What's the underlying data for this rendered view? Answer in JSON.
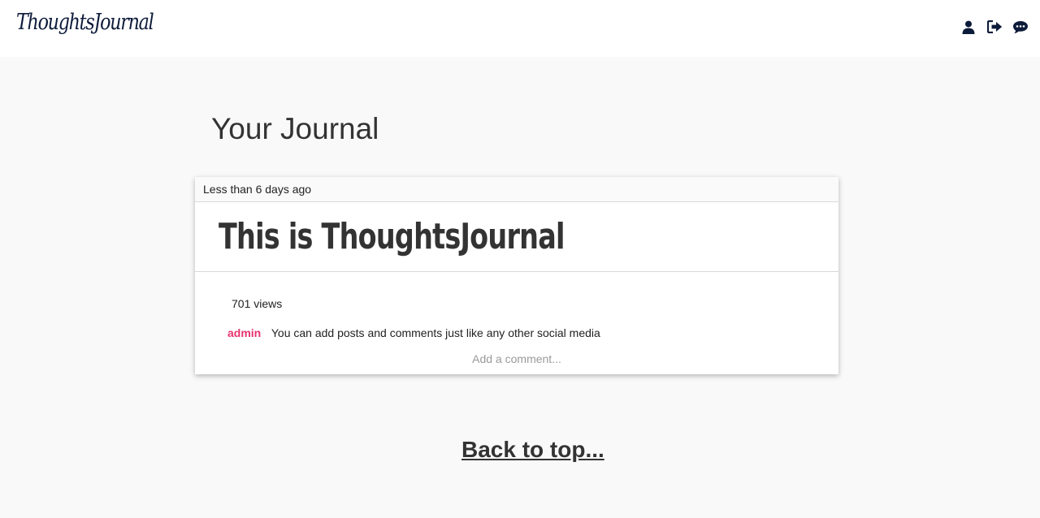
{
  "navbar": {
    "brand": "ThoughtsJournal",
    "icons": [
      "user-icon",
      "sign-out-icon",
      "comments-icon"
    ],
    "icon_color": "#0d1b3a"
  },
  "page": {
    "title": "Your Journal"
  },
  "post": {
    "timestamp": "Less than 6 days ago",
    "title": "This is ThoughtsJournal",
    "views": "701 views",
    "comments": [
      {
        "author": "admin",
        "text": "You can add posts and comments just like any other social media"
      }
    ],
    "comment_placeholder": "Add a comment..."
  },
  "footer": {
    "back_to_top": "Back to top..."
  },
  "colors": {
    "background": "#f9f9f9",
    "accent_author": "#e8336e",
    "brand": "#0d1b3a"
  }
}
